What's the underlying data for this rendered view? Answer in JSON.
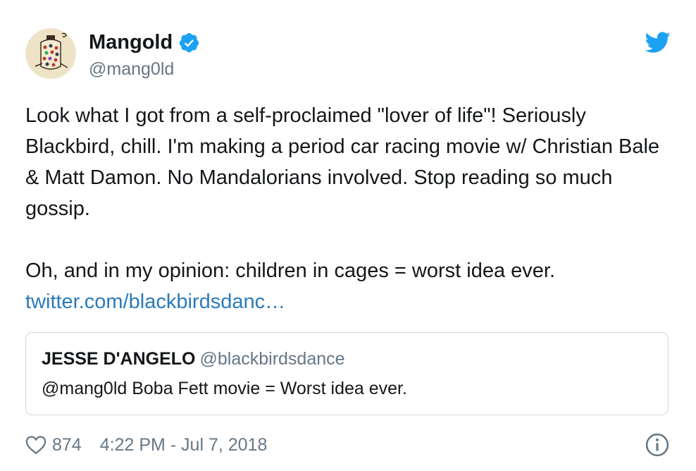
{
  "author": {
    "display_name": "Mangold",
    "handle": "@mang0ld",
    "verified": true
  },
  "tweet": {
    "paragraph_1": "Look what I got from a self-proclaimed \"lover of life\"! Seriously Blackbird, chill. I'm making a period car racing movie w/ Christian Bale & Matt Damon. No Mandalorians involved. Stop reading so much gossip.",
    "paragraph_2": "Oh, and in my opinion:  children in cages = worst idea ever.",
    "link_text": "twitter.com/blackbirdsdanc…"
  },
  "quoted_tweet": {
    "name": "JESSE D'ANGELO",
    "handle": "@blackbirdsdance",
    "text": "@mang0ld Boba Fett movie = Worst idea ever."
  },
  "footer": {
    "likes": "874",
    "timestamp": "4:22 PM - Jul 7, 2018"
  },
  "icons": {
    "verified": "verified-badge-icon",
    "bird": "twitter-bird-icon",
    "heart": "heart-icon",
    "info": "info-icon"
  },
  "colors": {
    "text": "#14171a",
    "secondary": "#657786",
    "link": "#2b7bb9",
    "brand_blue": "#1da1f2",
    "border": "#ccd6dd"
  }
}
